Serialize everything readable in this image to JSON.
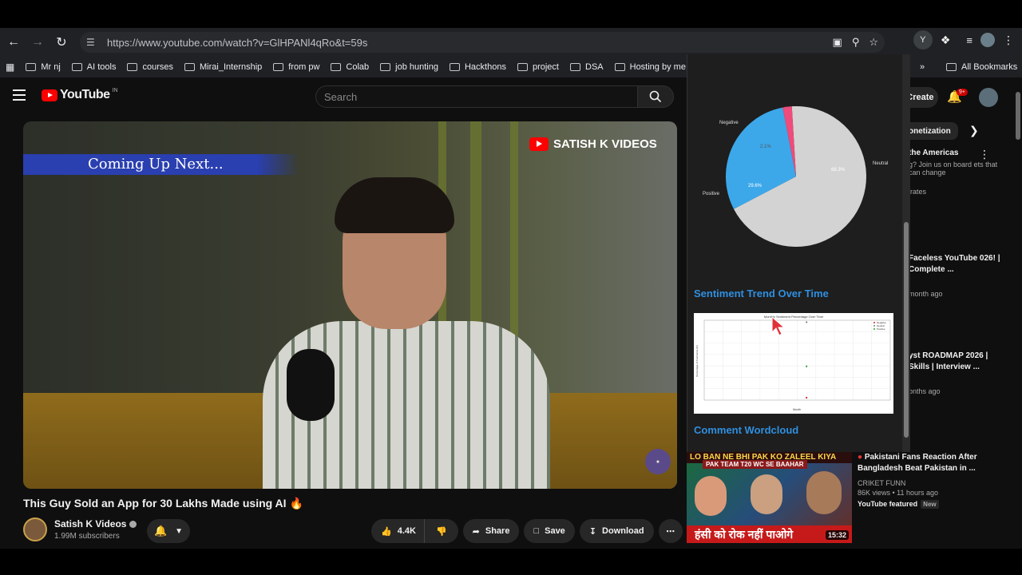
{
  "browser": {
    "url": "https://www.youtube.com/watch?v=GlHPANl4qRo&t=59s",
    "profile_initial": "Y"
  },
  "bookmarks": {
    "items": [
      "Mr nj",
      "AI  tools",
      "courses",
      "Mirai_Internship",
      "from pw",
      "Colab",
      "job hunting",
      "Hackthons",
      "project",
      "DSA",
      "Hosting by me"
    ],
    "overflow": "»",
    "all_label": "All Bookmarks"
  },
  "youtube": {
    "logo_text": "YouTube",
    "logo_country": "IN",
    "search_placeholder": "Search",
    "create_label": "Create",
    "notification_count": "9+"
  },
  "video": {
    "coming_up": "Coming Up Next...",
    "watermark": "SATISH K VIDEOS",
    "title": "This Guy Sold an App for 30 Lakhs Made using AI 🔥",
    "channel": "Satish K Videos",
    "subscribers": "1.99M subscribers",
    "likes": "4.4K",
    "share_label": "Share",
    "save_label": "Save",
    "download_label": "Download"
  },
  "extension_panel": {
    "pie_labels": {
      "negative": "Negative",
      "positive": "Positive",
      "neutral": "Neutral"
    },
    "pie_pct": {
      "negative": "2.1%",
      "positive": "29.6%",
      "neutral": "68.3%"
    },
    "trend_heading": "Sentiment Trend Over Time",
    "trend_chart_title": "Monthly Sentiment Percentage Over Time",
    "trend_legend": [
      "Negative",
      "Neutral",
      "Positive"
    ],
    "trend_xlabel": "Month",
    "trend_ylabel": "Percentage of Comments (%)",
    "wordcloud_heading": "Comment Wordcloud"
  },
  "chart_data": [
    {
      "type": "pie",
      "categories": [
        "Negative",
        "Positive",
        "Neutral"
      ],
      "values": [
        2.1,
        29.6,
        68.3
      ],
      "colors": [
        "#ef4b7b",
        "#3ca8ea",
        "#d3d3d3"
      ]
    },
    {
      "type": "scatter",
      "title": "Monthly Sentiment Percentage Over Time",
      "xlabel": "Month",
      "ylabel": "Percentage of Comments (%)",
      "ylim": [
        0,
        70
      ],
      "series": [
        {
          "name": "Negative",
          "values": [
            2.1
          ]
        },
        {
          "name": "Neutral",
          "values": [
            68.3
          ]
        },
        {
          "name": "Positive",
          "values": [
            29.6
          ]
        }
      ]
    }
  ],
  "related": [
    {
      "title": "the Americas",
      "desc": "g? Join us on board ets that can change",
      "meta": "irates"
    },
    {
      "title": "Faceless YouTube 026! | Complete ...",
      "meta": "month ago"
    },
    {
      "title": "yst ROADMAP 2026 | Skills | Interview ...",
      "meta": "onths ago"
    }
  ],
  "chip_label": "onetization",
  "bottom_card": {
    "thumb_top": "LO BAN NE BHI PAK KO ZALEEL KIYA",
    "thumb_sub": "PAK TEAM T20 WC SE BAAHAR",
    "thumb_bottom": "हंसी को रोक नहीं पाओगे",
    "duration": "15:32",
    "title": "Pakistani Fans Reaction After Bangladesh Beat Pakistan in ...",
    "channel": "CRIKET FUNN",
    "meta": "86K views • 11 hours ago",
    "featured": "YouTube featured",
    "new_badge": "New"
  }
}
